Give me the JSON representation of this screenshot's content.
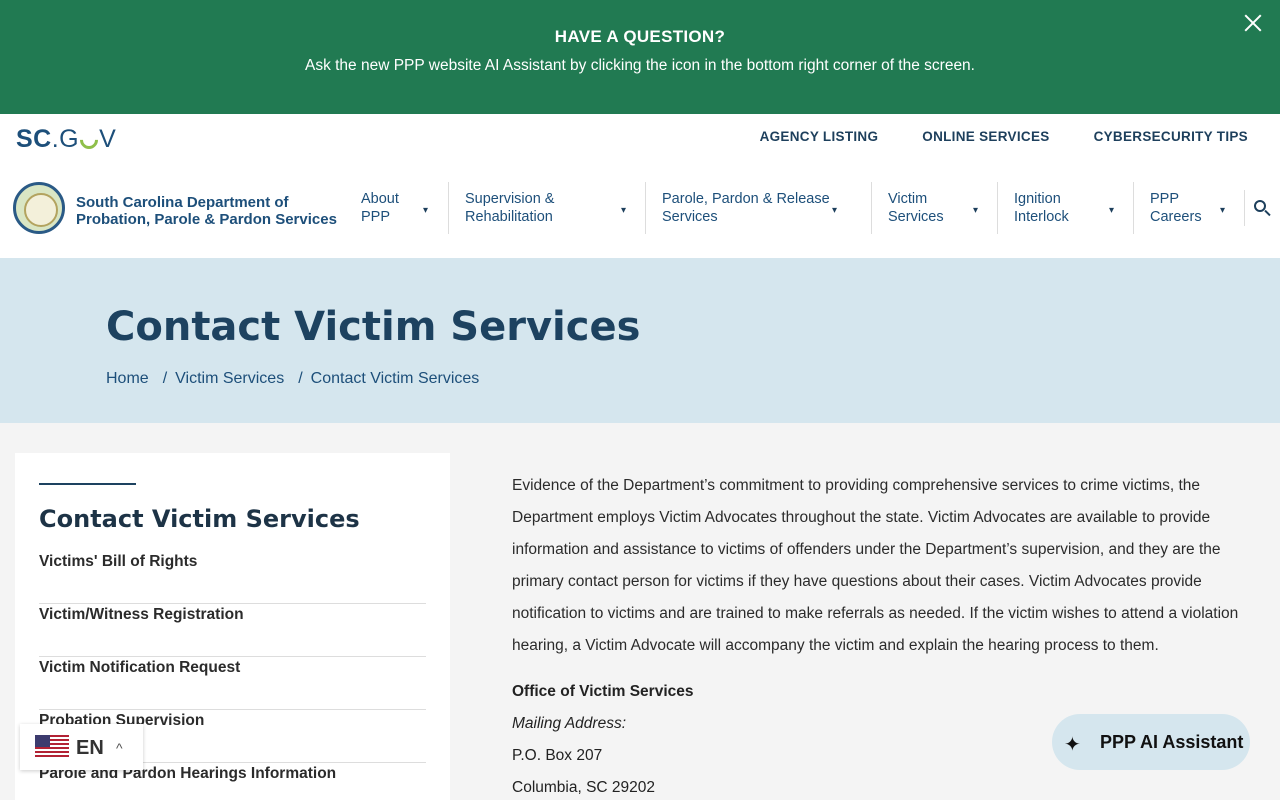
{
  "banner": {
    "title": "HAVE A QUESTION?",
    "text": "Ask the new PPP website AI Assistant by clicking the icon in the bottom right corner of the screen.",
    "close_icon": "close-icon"
  },
  "header": {
    "scgov_sc": "SC",
    "scgov_go": ".G",
    "scgov_v": "V",
    "utility_links": [
      "AGENCY LISTING",
      "ONLINE SERVICES",
      "CYBERSECURITY TIPS"
    ],
    "agency_line1": "South Carolina Department of",
    "agency_line2": "Probation, Parole & Pardon Services",
    "nav": [
      {
        "line1": "About",
        "line2": "PPP"
      },
      {
        "line1": "Supervision &",
        "line2": "Rehabilitation"
      },
      {
        "line1": "Parole, Pardon & Release",
        "line2": "Services"
      },
      {
        "line1": "Victim",
        "line2": "Services"
      },
      {
        "line1": "Ignition",
        "line2": "Interlock"
      },
      {
        "line1": "PPP",
        "line2": "Careers"
      }
    ],
    "caret": "▾"
  },
  "hero": {
    "title": "Contact Victim Services",
    "breadcrumb": [
      "Home",
      "Victim Services",
      "Contact Victim Services"
    ],
    "separator": "/"
  },
  "sidebar": {
    "title": "Contact Victim Services",
    "items": [
      "Victims' Bill of Rights",
      "Victim/Witness Registration",
      "Victim Notification Request",
      "Probation Supervision",
      "Parole and Pardon Hearings Information"
    ]
  },
  "main": {
    "body": "Evidence of the Department’s commitment to providing comprehensive services to crime victims, the Department employs Victim Advocates throughout the state. Victim Advocates are available to provide information and assistance to victims of offenders under the Department’s supervision, and they are the primary contact person for victims if they have questions about their cases. Victim Advocates provide notification to victims and are trained to make referrals as needed. If the victim wishes to attend a violation hearing, a Victim Advocate will accompany the victim and explain the hearing process to them.",
    "office_title": "Office of Victim Services",
    "mailing_label": "Mailing Address:",
    "po_box": "P.O. Box 207",
    "city": "Columbia, SC  29202"
  },
  "language": {
    "code": "EN",
    "chevron": "^"
  },
  "ai_assistant": {
    "label": "PPP AI Assistant",
    "icon": "sparkle-icon",
    "glyph": "✦"
  }
}
